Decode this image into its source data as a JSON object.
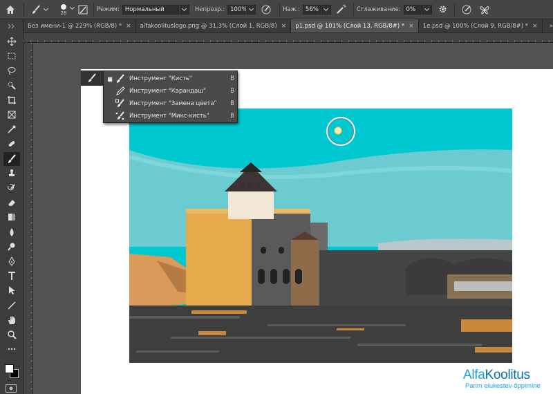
{
  "options_bar": {
    "brush_size": "28",
    "mode_label": "Режим:",
    "mode_value": "Нормальный",
    "opacity_label": "Непрозр.:",
    "opacity_value": "100%",
    "pressure_label": "Наж.:",
    "pressure_value": "56%",
    "smoothing_label": "Сглаживание:",
    "smoothing_value": "0%"
  },
  "tabs": [
    {
      "label": "Без имени-1 @ 229% (RGB/8) *",
      "active": false
    },
    {
      "label": "alfakoolituslogo.png @ 31,3% (Слой 1, RGB/8)",
      "active": false
    },
    {
      "label": "p1.psd @ 101% (Слой 13, RGB/8#) *",
      "active": true
    },
    {
      "label": "1e.psd @ 100% (Слой 9, RGB/8#) *",
      "active": false
    }
  ],
  "tab_close_glyph": "×",
  "tab_more_glyph": "»",
  "flyout": {
    "items": [
      {
        "label": "Инструмент \"Кисть\"",
        "shortcut": "B",
        "selected": true,
        "icon": "brush-icon"
      },
      {
        "label": "Инструмент \"Карандаш\"",
        "shortcut": "B",
        "selected": false,
        "icon": "pencil-icon"
      },
      {
        "label": "Инструмент \"Замена цвета\"",
        "shortcut": "B",
        "selected": false,
        "icon": "color-replacement-icon"
      },
      {
        "label": "Инструмент \"Микс-кисть\"",
        "shortcut": "B",
        "selected": false,
        "icon": "mixer-brush-icon"
      }
    ]
  },
  "toolbar": {
    "tools": [
      "move-icon",
      "marquee-icon",
      "lasso-icon",
      "quick-select-icon",
      "crop-icon",
      "frame-icon",
      "eyedropper-icon",
      "healing-icon",
      "brush-icon",
      "clone-stamp-icon",
      "history-brush-icon",
      "eraser-icon",
      "gradient-icon",
      "blur-icon",
      "dodge-icon",
      "pen-icon",
      "type-icon",
      "path-select-icon",
      "line-icon",
      "hand-icon",
      "zoom-icon",
      "more-icon"
    ],
    "selected": "brush-icon"
  },
  "colors": {
    "sky": "#00c8d0",
    "sky_low": "#6ccbd0",
    "tower": "#e3a447",
    "stone": "#4a4a4a",
    "accent": "#1a9fe0"
  },
  "watermark": {
    "brand_a": "Alfa",
    "brand_b": "Koolitus",
    "slogan": "Parim elukestev õppimine"
  }
}
